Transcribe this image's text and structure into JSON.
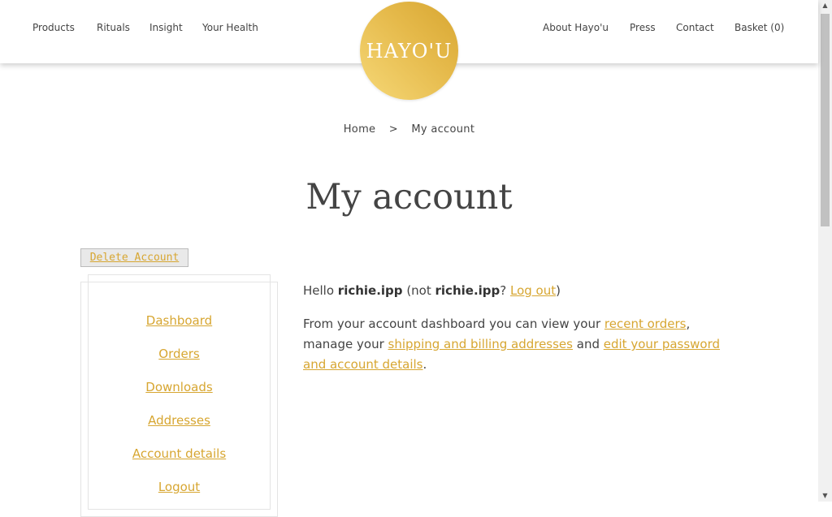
{
  "header": {
    "nav_left": [
      "Products",
      "Rituals",
      "Insight",
      "Your Health"
    ],
    "nav_right": [
      "About Hayo'u",
      "Press",
      "Contact",
      "Basket (0)"
    ],
    "logo_text": "HAYO'U"
  },
  "breadcrumb": {
    "home": "Home",
    "separator": ">",
    "current": "My account"
  },
  "page": {
    "title": "My account"
  },
  "delete_button": "Delete Account",
  "sidebar": {
    "items": [
      "Dashboard",
      "Orders",
      "Downloads",
      "Addresses",
      "Account details",
      "Logout"
    ]
  },
  "content": {
    "hello": "Hello ",
    "username": "richie.ipp",
    "not_open": " (not ",
    "username2": "richie.ipp",
    "question": "? ",
    "logout_link": "Log out",
    "close_paren": ")",
    "dash_intro": "From your account dashboard you can view your ",
    "recent_orders": "recent orders",
    "manage": ", manage your ",
    "addresses_link": "shipping and billing addresses",
    "and": " and ",
    "edit_link": "edit your password and account details",
    "period": "."
  },
  "colors": {
    "accent": "#d7a631",
    "text": "#444444"
  }
}
